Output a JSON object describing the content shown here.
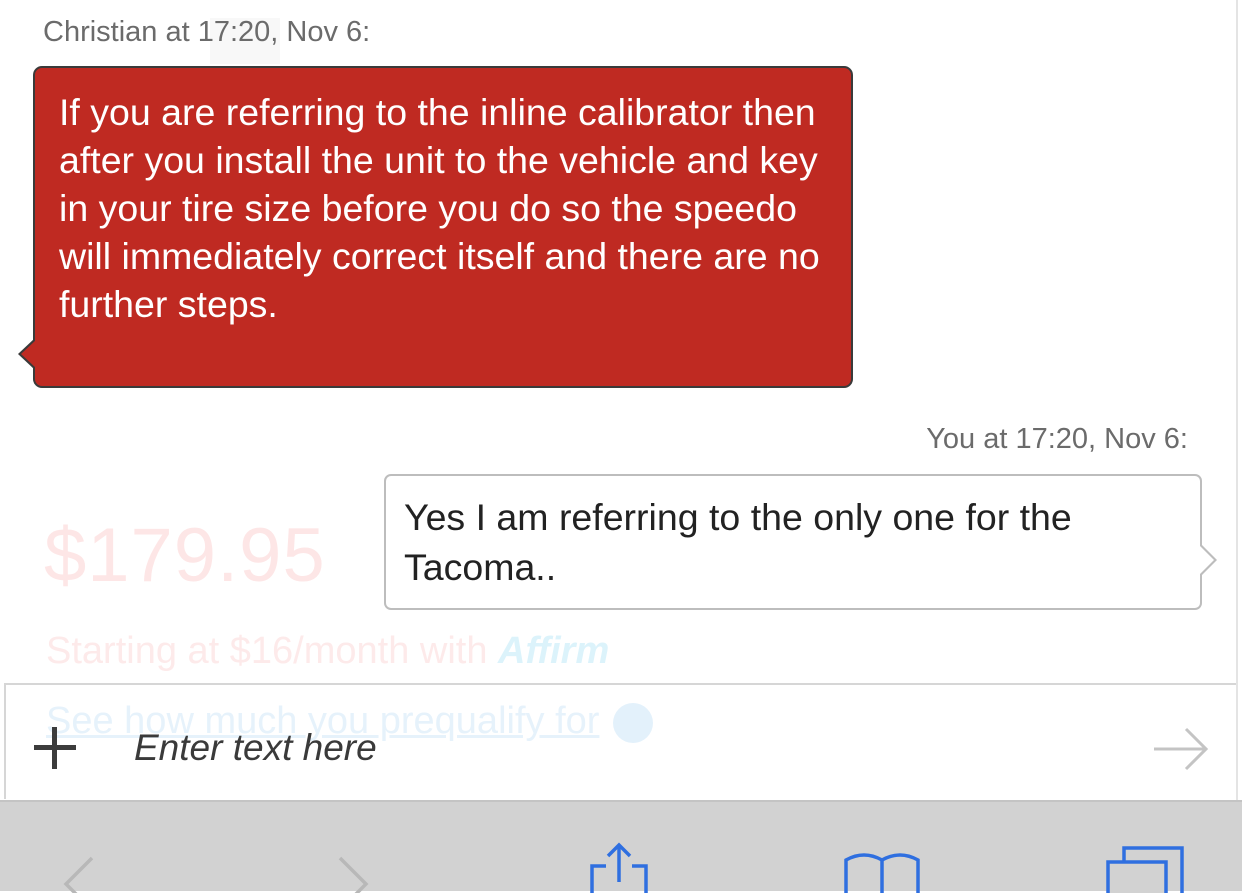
{
  "background": {
    "price": "$179.95",
    "financing_prefix": "Starting at $16/month with",
    "financing_brand": "Affirm",
    "prequalify_link": "See how much you prequalify for"
  },
  "chat": {
    "messages": [
      {
        "sender_header": "Christian at 17:20, Nov 6:",
        "text": "If you are referring to the inline calibrator then after you install the unit to the vehicle and key in your tire size before you do so the speedo will immediately correct itself and there are no further steps."
      },
      {
        "sender_header": "You at 17:20, Nov 6:",
        "text": "Yes I am referring to the only one for the Tacoma.."
      }
    ],
    "input": {
      "placeholder": "Enter text here",
      "value": ""
    }
  },
  "icons": {
    "add": "plus-icon",
    "send": "arrow-right-icon",
    "back": "chevron-left-icon",
    "forward": "chevron-right-icon",
    "share": "share-icon",
    "bookmarks": "book-icon",
    "tabs": "tabs-icon"
  },
  "colors": {
    "agent_bubble": "#bf2a22",
    "user_bubble_border": "#bdbdbd",
    "toolbar_bg": "#d2d2d2",
    "toolbar_icon": "#2f6fe0"
  }
}
